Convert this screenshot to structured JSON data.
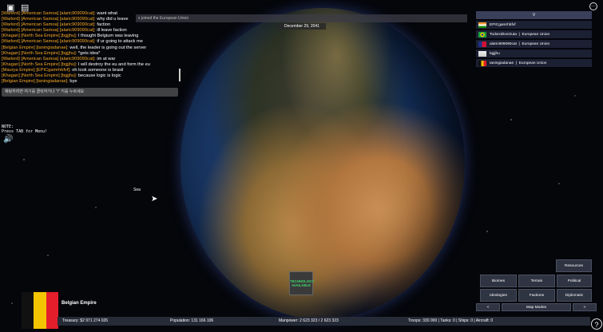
{
  "top_icons": {
    "roblox": "roblox-logo-icon",
    "chat": "chat-icon",
    "menu_label": "···"
  },
  "chat": {
    "lines": [
      {
        "tag": "[Warlord]",
        "team": "[American Samoa]",
        "user": "[alaric909090cat]:",
        "msg": "want what"
      },
      {
        "tag": "[Warlord]",
        "team": "[American Samoa]",
        "user": "[alaric909090cat]:",
        "msg": "why did u leave"
      },
      {
        "tag": "[Warlord]",
        "team": "[American Samoa]",
        "user": "[alaric909090cat]:",
        "msg": "faction"
      },
      {
        "tag": "[Warlord]",
        "team": "[American Samoa]",
        "user": "[alaric909090cat]:",
        "msg": "ill leave faction"
      },
      {
        "tag": "[Khagan]",
        "team": "[North Sea Empire]",
        "user": "[bgjjhu]:",
        "msg": "I thought Belgium was leaving"
      },
      {
        "tag": "[Warlord]",
        "team": "[American Samoa]",
        "user": "[alaric909090cat]:",
        "msg": "if ur going to attack me"
      },
      {
        "tag": "[Belgian Empire]",
        "team": "",
        "user": "[taningiadanae]:",
        "msg": "well, the leader is going out the server"
      },
      {
        "tag": "[Khagan]",
        "team": "[North Sea Empire]",
        "user": "[bgjjhu]:",
        "msg": "*gets idea*"
      },
      {
        "tag": "[Warlord]",
        "team": "[American Samoa]",
        "user": "[alaric909090cat]:",
        "msg": "im at war"
      },
      {
        "tag": "[Khagan]",
        "team": "[North Sea Empire]",
        "user": "[bgjjhu]:",
        "msg": "I will destroy the eu and form the eu"
      },
      {
        "tag": "[Maurya Empire]",
        "team": "",
        "user": "[EPICgamrhbfvf]:",
        "msg": "oh look someone is brasil"
      },
      {
        "tag": "[Khagan]",
        "team": "[North Sea Empire]",
        "user": "[bgjjhu]:",
        "msg": "because logic is logic"
      },
      {
        "tag": "[Belgian Empire]",
        "team": "",
        "user": "[taningiadanae]:",
        "msg": "bye"
      }
    ],
    "input_placeholder": "채팅하려면 여기를 클릭하거나 \"/\" 키를 누르세요"
  },
  "notification": "s joined the European Union",
  "date": "December 29, 2041",
  "note": "NOTE:\nPress TAB for Menu!",
  "map_label": "Sea",
  "players": {
    "header": "V",
    "list": [
      {
        "name": "EPICgamrhbfvf",
        "faction": "",
        "flag": "india"
      },
      {
        "name": "TodoroklonOuta",
        "faction": "European Union",
        "flag": "brazil"
      },
      {
        "name": "alaric909090cat",
        "faction": "European Union",
        "flag": "samoa"
      },
      {
        "name": "bgjjhu",
        "faction": "",
        "flag": "north-sea"
      },
      {
        "name": "taningiadanae",
        "faction": "European Union",
        "flag": "belgium"
      }
    ]
  },
  "tech_button": {
    "line1": "TECHNOLOGY",
    "line2": "AVAILABLE"
  },
  "country": {
    "name": "Belgian Empire",
    "flag_colors": [
      "#111111",
      "#f2c500",
      "#e41e2b"
    ]
  },
  "panel": {
    "resources": "Resources",
    "biomes": "Biomes",
    "terrain": "Terrain",
    "political": "Political",
    "ideologies": "Ideologies",
    "factions": "Factions",
    "diplomatic": "Diplomatic",
    "prev": "<",
    "map_modes": "Map Modes",
    "next": ">"
  },
  "stats": {
    "treasury": "Treasury:  $2 971 274 026",
    "population": "Population: 131 166 106",
    "manpower": "Manpower:   2 623 323  /  2 623 323",
    "troops": "Troops: 330 000  |  Tanks: 0  |  Ships: 0  |  Aircraft: 0"
  },
  "help_label": "?"
}
